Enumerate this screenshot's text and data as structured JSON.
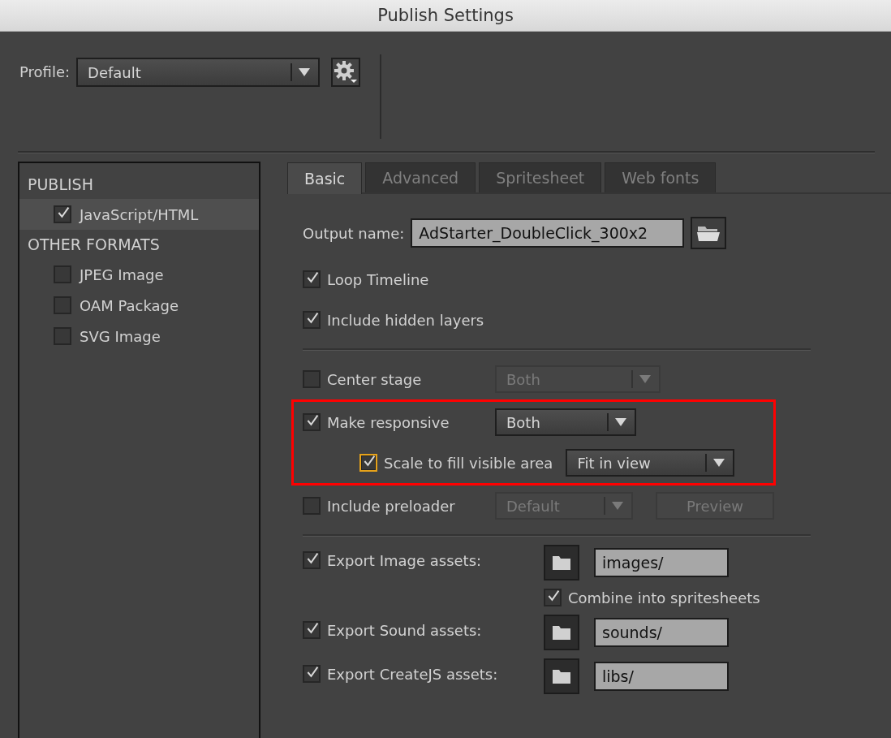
{
  "window": {
    "title": "Publish Settings"
  },
  "profile": {
    "label": "Profile:",
    "value": "Default"
  },
  "sidebar": {
    "sections": [
      {
        "heading": "PUBLISH",
        "items": [
          {
            "label": "JavaScript/HTML",
            "checked": true,
            "selected": true
          }
        ]
      },
      {
        "heading": "OTHER FORMATS",
        "items": [
          {
            "label": "JPEG Image",
            "checked": false,
            "selected": false
          },
          {
            "label": "OAM Package",
            "checked": false,
            "selected": false
          },
          {
            "label": "SVG Image",
            "checked": false,
            "selected": false
          }
        ]
      }
    ]
  },
  "tabs": [
    {
      "label": "Basic",
      "selected": true
    },
    {
      "label": "Advanced",
      "selected": false
    },
    {
      "label": "Spritesheet",
      "selected": false
    },
    {
      "label": "Web fonts",
      "selected": false
    }
  ],
  "output_name": {
    "label": "Output name:",
    "value": "AdStarter_DoubleClick_300x2"
  },
  "general_options": [
    {
      "kind": "check",
      "label": "Loop Timeline",
      "checked": true,
      "focused": false
    },
    {
      "kind": "check",
      "label": "Include hidden layers",
      "checked": true,
      "focused": false
    }
  ],
  "stage_options": [
    {
      "kind": "check-dropdown",
      "label": "Center stage",
      "checked": false,
      "focused": false,
      "highlighted": false,
      "dropdown": {
        "value": "Both",
        "disabled": true
      }
    },
    {
      "kind": "check-dropdown",
      "label": "Make responsive",
      "checked": true,
      "focused": false,
      "highlighted": true,
      "dropdown": {
        "value": "Both",
        "disabled": false
      },
      "children": [
        {
          "kind": "check-dropdown",
          "label": "Scale to fill visible area",
          "checked": true,
          "focused": true,
          "highlighted": false,
          "dropdown": {
            "value": "Fit in view",
            "disabled": false
          }
        }
      ]
    },
    {
      "kind": "check-dropdown-button",
      "label": "Include preloader",
      "checked": false,
      "focused": false,
      "highlighted": false,
      "dropdown": {
        "value": "Default",
        "disabled": true
      },
      "button": {
        "label": "Preview",
        "disabled": true
      }
    }
  ],
  "exports": [
    {
      "label": "Export Image assets:",
      "checked": true,
      "path": "images/",
      "children": [
        {
          "label": "Combine into spritesheets",
          "checked": true
        }
      ]
    },
    {
      "label": "Export Sound assets:",
      "checked": true,
      "path": "sounds/"
    },
    {
      "label": "Export CreateJS assets:",
      "checked": true,
      "path": "libs/"
    }
  ]
}
